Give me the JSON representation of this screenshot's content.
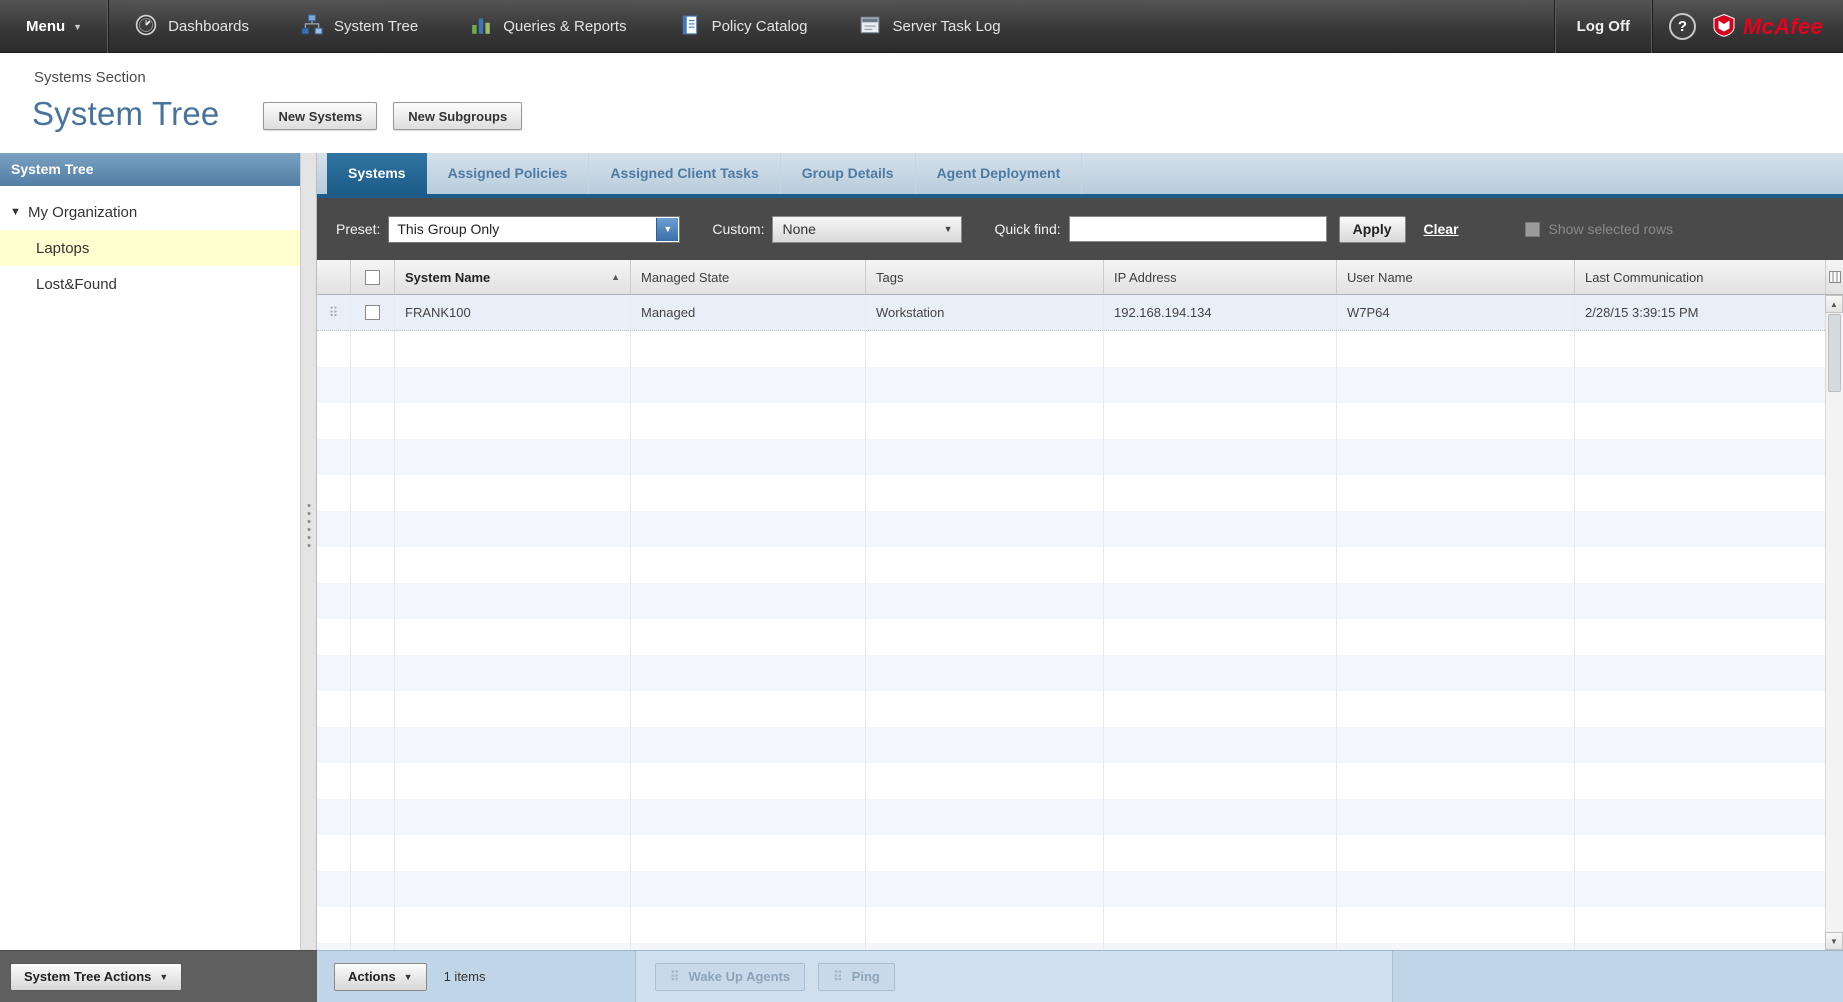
{
  "topnav": {
    "menu_label": "Menu",
    "items": [
      {
        "label": "Dashboards"
      },
      {
        "label": "System Tree"
      },
      {
        "label": "Queries & Reports"
      },
      {
        "label": "Policy Catalog"
      },
      {
        "label": "Server Task Log"
      }
    ],
    "logoff_label": "Log Off",
    "brand": "McAfee"
  },
  "header": {
    "breadcrumb": "Systems Section",
    "title": "System Tree",
    "new_systems_label": "New Systems",
    "new_subgroups_label": "New Subgroups"
  },
  "sidebar": {
    "title": "System Tree",
    "tree": [
      {
        "label": "My Organization"
      },
      {
        "label": "Laptops"
      },
      {
        "label": "Lost&Found"
      }
    ],
    "actions_label": "System Tree Actions"
  },
  "tabs": [
    {
      "label": "Systems"
    },
    {
      "label": "Assigned Policies"
    },
    {
      "label": "Assigned Client Tasks"
    },
    {
      "label": "Group Details"
    },
    {
      "label": "Agent Deployment"
    }
  ],
  "filterbar": {
    "preset_label": "Preset:",
    "preset_value": "This Group Only",
    "custom_label": "Custom:",
    "custom_value": "None",
    "quickfind_label": "Quick find:",
    "quickfind_value": "",
    "apply_label": "Apply",
    "clear_label": "Clear",
    "show_selected_label": "Show selected rows"
  },
  "table": {
    "columns": [
      "System Name",
      "Managed State",
      "Tags",
      "IP Address",
      "User Name",
      "Last Communication"
    ],
    "rows": [
      {
        "cells": [
          "FRANK100",
          "Managed",
          "Workstation",
          "192.168.194.134",
          "W7P64",
          "2/28/15 3:39:15 PM"
        ]
      }
    ]
  },
  "bottombar": {
    "actions_label": "Actions",
    "items_count": "1 items",
    "wake_label": "Wake Up Agents",
    "ping_label": "Ping"
  },
  "icons": {
    "chevron_down": "▼",
    "sort_asc": "▲",
    "scroll_up": "▲",
    "scroll_down": "▼",
    "tree_caret": "▼",
    "help": "?",
    "drag": "⠿"
  },
  "colors": {
    "accent_blue": "#1d5c88",
    "mcafee_red": "#e8001d",
    "selected_tree_yellow": "#ffffcf"
  }
}
